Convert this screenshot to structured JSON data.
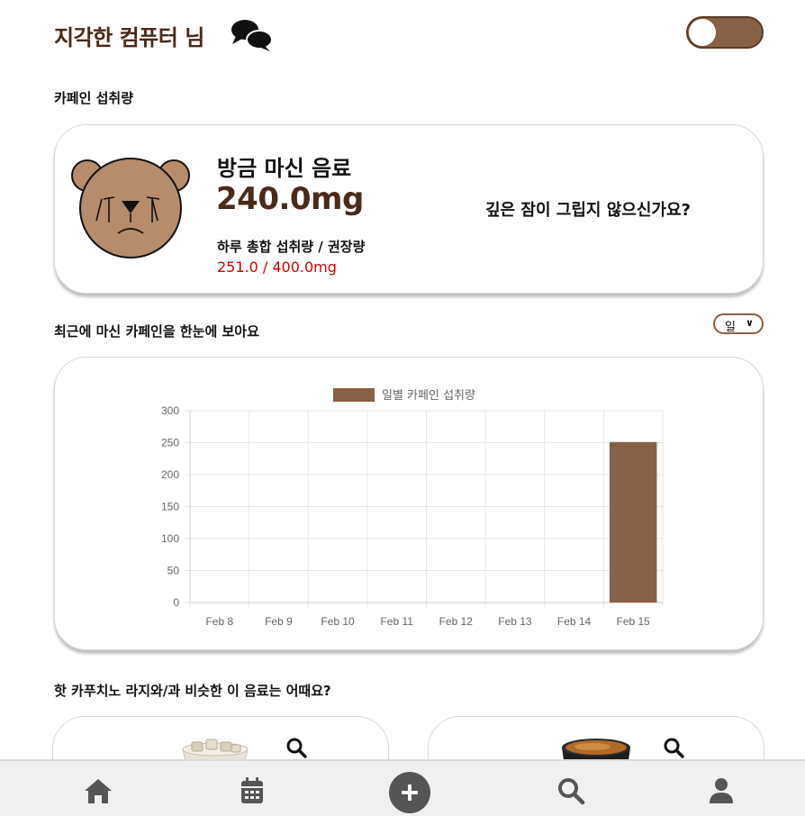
{
  "header": {
    "greeting": "지각한 컴퓨터 님",
    "chat_icon": "chat-bubbles-icon",
    "toggle_on": true
  },
  "colors": {
    "brand_brown": "#876045",
    "dark_brown": "#4a2a1a",
    "alert_red": "#d40000"
  },
  "caffeine": {
    "section_title": "카페인 섭취량",
    "recent_drink_label": "방금 마신 음료",
    "recent_drink_mg": "240.0mg",
    "total_label": "하루 총합 섭취량 / 권장량",
    "total_value": "251.0 / 400.0mg",
    "message": "깊은 잠이 그립지 않으신가요?",
    "mascot": "crying-bear-icon"
  },
  "history": {
    "section_title": "최근에 마신 카페인을 한눈에 보아요",
    "period_selected": "일"
  },
  "chart_data": {
    "type": "bar",
    "categories": [
      "Feb 8",
      "Feb 9",
      "Feb 10",
      "Feb 11",
      "Feb 12",
      "Feb 13",
      "Feb 14",
      "Feb 15"
    ],
    "series": [
      {
        "name": "일별 카페인 섭취량",
        "values": [
          0,
          0,
          0,
          0,
          0,
          0,
          0,
          251
        ],
        "color": "#876045"
      }
    ],
    "yticks": [
      0,
      50,
      100,
      150,
      200,
      250,
      300
    ],
    "ylim": [
      0,
      300
    ],
    "grid": true,
    "legend": "top-center"
  },
  "recommendations": {
    "section_title": "핫 카푸치노 라지와/과 비슷한 이 음료는 어때요?",
    "items": [
      {
        "image": "iced-drink-icon",
        "search_icon": "search-icon"
      },
      {
        "image": "black-coffee-cup-icon",
        "search_icon": "search-icon"
      }
    ]
  },
  "nav": {
    "items": [
      {
        "name": "home",
        "icon": "home-icon"
      },
      {
        "name": "calendar",
        "icon": "calendar-icon"
      },
      {
        "name": "add",
        "icon": "plus-circle-icon"
      },
      {
        "name": "search",
        "icon": "search-icon"
      },
      {
        "name": "profile",
        "icon": "user-icon"
      }
    ]
  }
}
